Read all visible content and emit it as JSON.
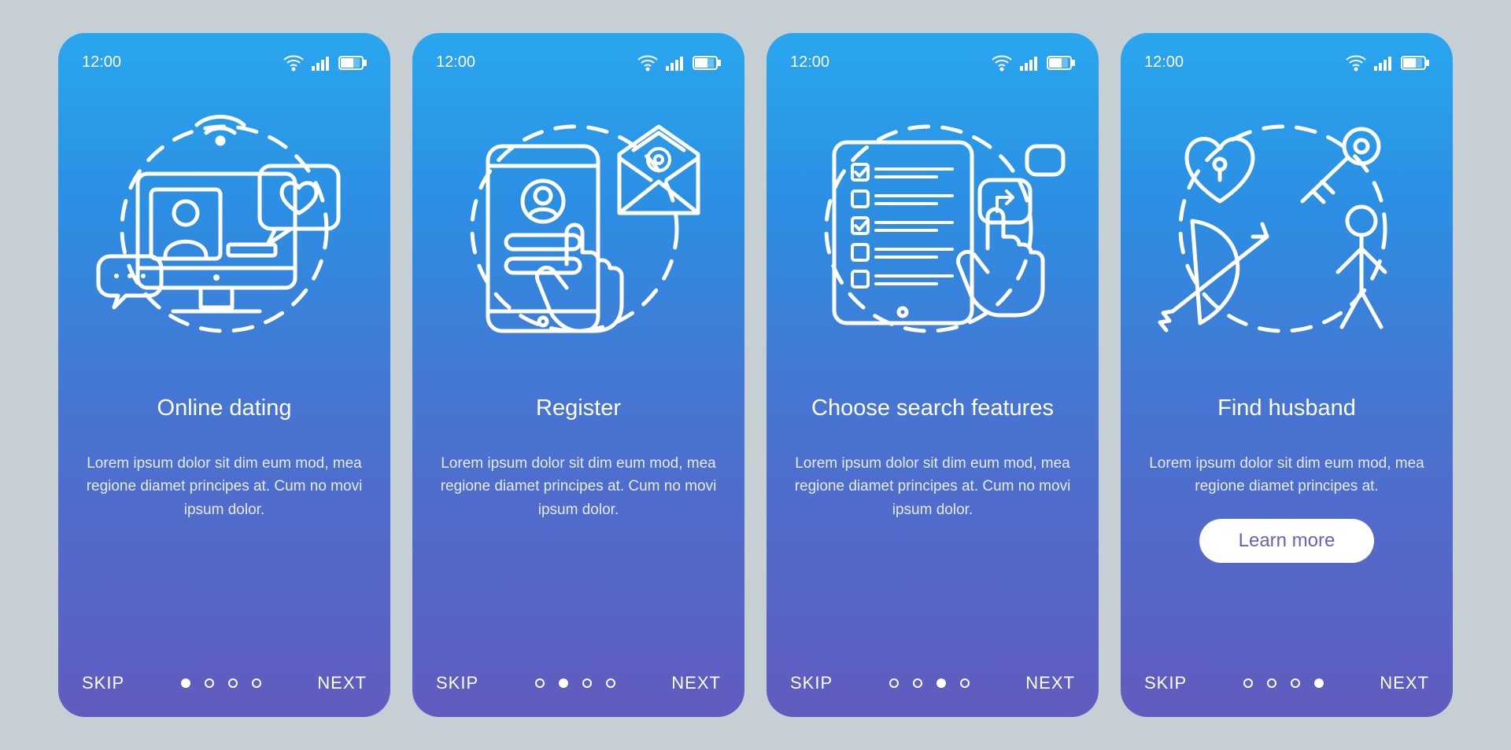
{
  "status": {
    "time": "12:00"
  },
  "screens": [
    {
      "title": "Online dating",
      "description": "Lorem ipsum dolor sit dim eum mod, mea regione diamet principes at. Cum no movi ipsum dolor.",
      "skip": "SKIP",
      "next": "NEXT",
      "activeDot": 0,
      "learn": null
    },
    {
      "title": "Register",
      "description": "Lorem ipsum dolor sit dim eum mod, mea regione diamet principes at. Cum no movi ipsum dolor.",
      "skip": "SKIP",
      "next": "NEXT",
      "activeDot": 1,
      "learn": null
    },
    {
      "title": "Choose search features",
      "description": "Lorem ipsum dolor sit dim eum mod, mea regione diamet principes at. Cum no movi ipsum dolor.",
      "skip": "SKIP",
      "next": "NEXT",
      "activeDot": 2,
      "learn": null
    },
    {
      "title": "Find husband",
      "description": "Lorem ipsum dolor sit dim eum mod, mea regione diamet principes at.",
      "skip": "SKIP",
      "next": "NEXT",
      "activeDot": 3,
      "learn": "Learn more"
    }
  ]
}
